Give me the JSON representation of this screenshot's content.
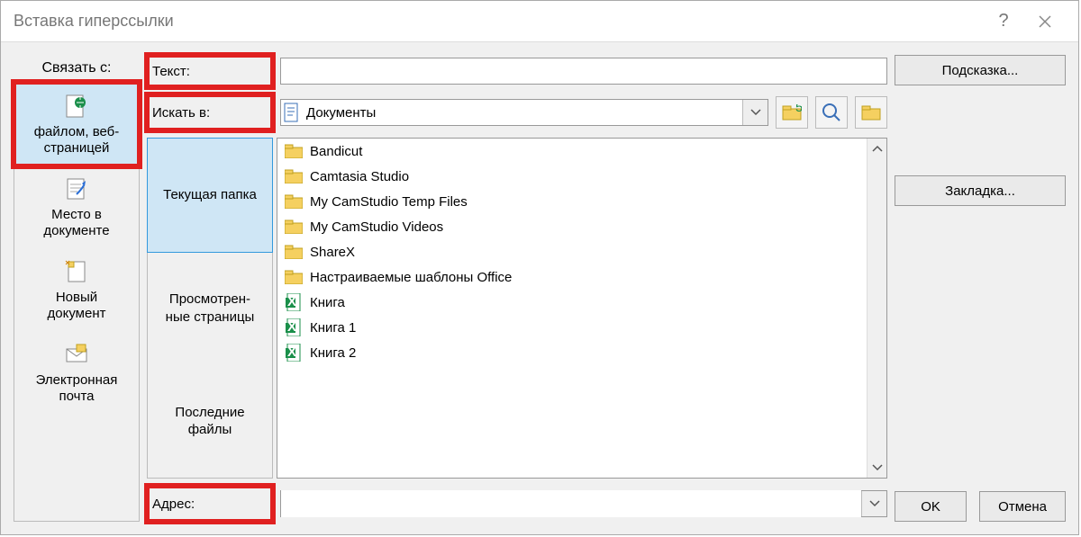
{
  "title": "Вставка гиперссылки",
  "linkto_label": "Связать с:",
  "linkto": [
    {
      "label_l1": "файлом, веб-",
      "label_l2": "страницей",
      "key": "в"
    },
    {
      "label_l1": "Место в",
      "label_l2": "документе",
      "key": "М"
    },
    {
      "label_l1": "Новый",
      "label_l2": "документ",
      "key": "Н"
    },
    {
      "label_l1": "Электронная",
      "label_l2": "почта",
      "key": "н"
    }
  ],
  "text_label": "Текст:",
  "text_value": "",
  "hint_button": "Подсказка...",
  "lookin_label": "Искать в:",
  "lookin_value": "Документы",
  "tabs": [
    "Текущая папка",
    "Просмотрен-\nные страницы",
    "Последние файлы"
  ],
  "files": [
    {
      "type": "folder",
      "name": "Bandicut"
    },
    {
      "type": "folder",
      "name": "Camtasia Studio"
    },
    {
      "type": "folder",
      "name": "My CamStudio Temp Files"
    },
    {
      "type": "folder",
      "name": "My CamStudio Videos"
    },
    {
      "type": "folder",
      "name": "ShareX"
    },
    {
      "type": "folder",
      "name": "Настраиваемые шаблоны Office"
    },
    {
      "type": "excel",
      "name": "Книга"
    },
    {
      "type": "excel",
      "name": "Книга 1"
    },
    {
      "type": "excel",
      "name": "Книга 2"
    }
  ],
  "bookmark_button": "Закладка...",
  "address_label": "Адрес:",
  "address_value": "",
  "ok": "OK",
  "cancel": "Отмена"
}
